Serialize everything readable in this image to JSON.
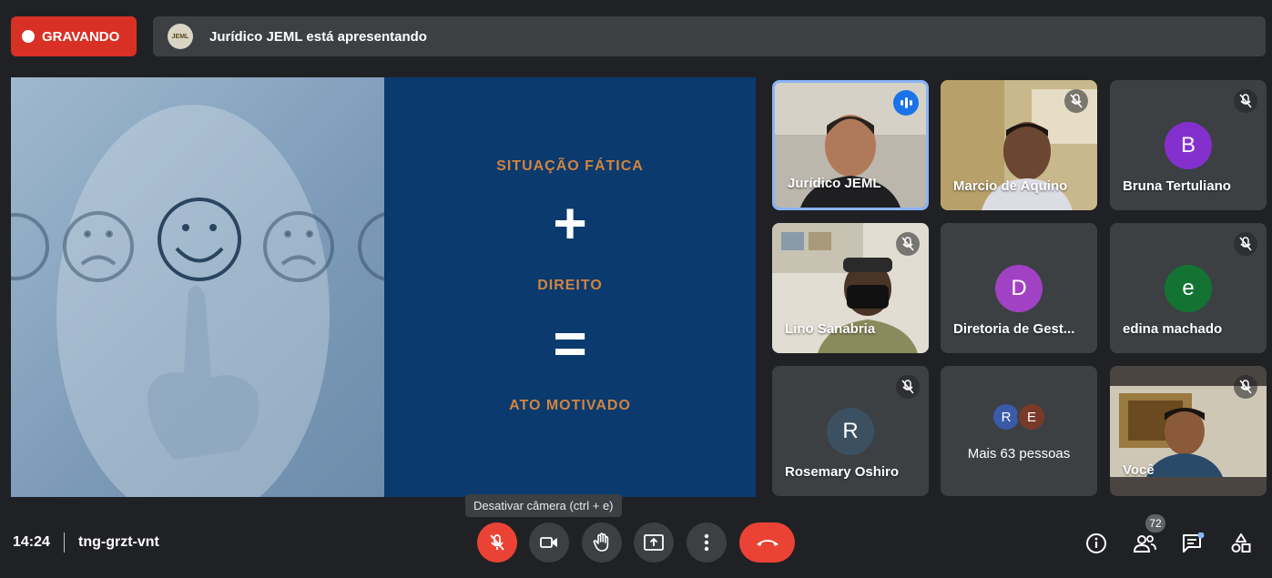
{
  "recording": {
    "label": "GRAVANDO"
  },
  "presenting": {
    "avatar_text": "JEML",
    "text": "Jurídico JEML está apresentando"
  },
  "slide": {
    "line1": "SITUAÇÃO FÁTICA",
    "plus": "+",
    "line2": "DIREITO",
    "equals": "=",
    "line3": "ATO MOTIVADO"
  },
  "participants": [
    {
      "name": "Jurídico JEML",
      "type": "video",
      "speaking": true
    },
    {
      "name": "Marcio de Aquino",
      "type": "video",
      "muted": true
    },
    {
      "name": "Bruna Tertuliano",
      "type": "initial",
      "initial": "B",
      "color": "#8430ce",
      "muted": true
    },
    {
      "name": "Lino Sanabria",
      "type": "video",
      "muted": true
    },
    {
      "name": "Diretoria de Gest...",
      "type": "initial",
      "initial": "D",
      "color": "#a142c4"
    },
    {
      "name": "edina machado",
      "type": "initial",
      "initial": "e",
      "color": "#137333",
      "muted": true
    },
    {
      "name": "Rosemary Oshiro",
      "type": "initial",
      "initial": "R",
      "color": "#3b5161",
      "muted": true
    },
    {
      "name": "Mais 63 pessoas",
      "type": "more",
      "avatars": [
        "R",
        "E"
      ]
    },
    {
      "name": "Você",
      "type": "video",
      "muted": true
    }
  ],
  "tooltip": "Desativar câmera (ctrl + e)",
  "meeting": {
    "time": "14:24",
    "code": "tng-grzt-vnt"
  },
  "people_count": "72",
  "icons": [
    "mic-off-icon",
    "camera-icon",
    "hand-icon",
    "present-icon",
    "more-icon",
    "end-call-icon",
    "info-icon",
    "people-icon",
    "chat-icon",
    "activities-icon"
  ]
}
